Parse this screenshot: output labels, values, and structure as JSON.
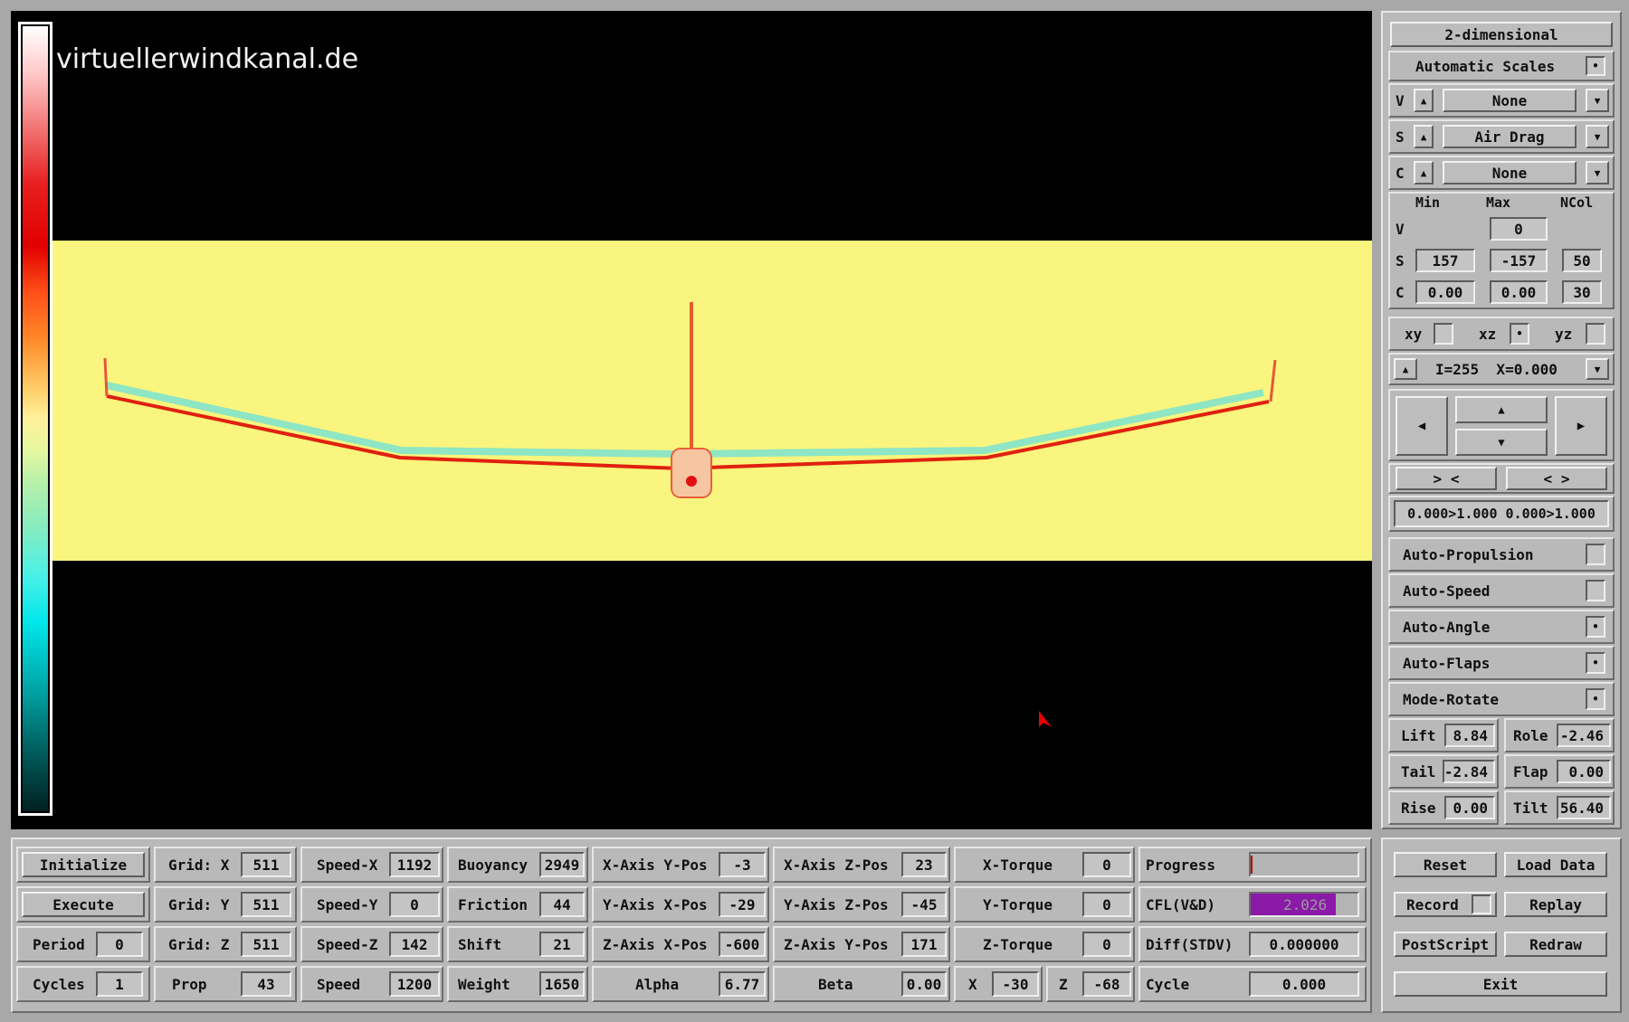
{
  "view": {
    "watermark": "virtuellerwindkanal.de"
  },
  "side": {
    "mode_button": "2-dimensional",
    "auto_scales": "Automatic Scales",
    "v_label": "V",
    "v_value": "None",
    "s_label": "S",
    "s_value": "Air Drag",
    "c_label": "C",
    "c_value": "None",
    "head_min": "Min",
    "head_max": "Max",
    "head_ncol": "NCol",
    "row_v": {
      "label": "V",
      "max": "0"
    },
    "row_s": {
      "label": "S",
      "min": "157",
      "max": "-157",
      "ncol": "50"
    },
    "row_c": {
      "label": "C",
      "min": "0.00",
      "max": "0.00",
      "ncol": "30"
    },
    "plane_xy": "xy",
    "plane_xz": "xz",
    "plane_yz": "yz",
    "slice_text": "I=255  X=0.000",
    "zoom_in": "> <",
    "zoom_out": "< >",
    "range_text": "0.000>1.000 0.000>1.000",
    "toggles": [
      "Auto-Propulsion",
      "Auto-Speed",
      "Auto-Angle",
      "Auto-Flaps",
      "Mode-Rotate"
    ],
    "lift_label": "Lift",
    "lift_value": "8.84",
    "role_label": "Role",
    "role_value": "-2.46",
    "tail_label": "Tail",
    "tail_value": "-2.84",
    "flap_label": "Flap",
    "flap_value": "0.00",
    "rise_label": "Rise",
    "rise_value": "0.00",
    "tilt_label": "Tilt",
    "tilt_value": "56.40"
  },
  "bottom": {
    "initialize": "Initialize",
    "execute": "Execute",
    "period_label": "Period",
    "period_value": "0",
    "cycles_label": "Cycles",
    "cycles_value": "1",
    "gridx_label": "Grid: X",
    "gridx_value": "511",
    "gridy_label": "Grid: Y",
    "gridy_value": "511",
    "gridz_label": "Grid: Z",
    "gridz_value": "511",
    "prop_label": "Prop",
    "prop_value": "43",
    "speedx_label": "Speed-X",
    "speedx_value": "1192",
    "speedy_label": "Speed-Y",
    "speedy_value": "0",
    "speedz_label": "Speed-Z",
    "speedz_value": "142",
    "speed_label": "Speed",
    "speed_value": "1200",
    "buoyancy_label": "Buoyancy",
    "buoyancy_value": "2949",
    "friction_label": "Friction",
    "friction_value": "44",
    "shift_label": "Shift",
    "shift_value": "21",
    "weight_label": "Weight",
    "weight_value": "1650",
    "xaxis_ypos_label": "X-Axis Y-Pos",
    "xaxis_ypos_value": "-3",
    "yaxis_xpos_label": "Y-Axis X-Pos",
    "yaxis_xpos_value": "-29",
    "zaxis_xpos_label": "Z-Axis X-Pos",
    "zaxis_xpos_value": "-600",
    "alpha_label": "Alpha",
    "alpha_value": "6.77",
    "xaxis_zpos_label": "X-Axis Z-Pos",
    "xaxis_zpos_value": "23",
    "yaxis_zpos_label": "Y-Axis Z-Pos",
    "yaxis_zpos_value": "-45",
    "zaxis_ypos_label": "Z-Axis Y-Pos",
    "zaxis_ypos_value": "171",
    "beta_label": "Beta",
    "beta_value": "0.00",
    "xtorque_label": "X-Torque",
    "xtorque_value": "0",
    "ytorque_label": "Y-Torque",
    "ytorque_value": "0",
    "ztorque_label": "Z-Torque",
    "ztorque_value": "0",
    "x_label": "X",
    "x_value": "-30",
    "z_label": "Z",
    "z_value": "-68",
    "progress_label": "Progress",
    "cfl_label": "CFL(V&D)",
    "cfl_value": "2.026",
    "diff_label": "Diff(STDV)",
    "diff_value": "0.000000",
    "cycle_label": "Cycle",
    "cycle_value": "0.000",
    "reset": "Reset",
    "load_data": "Load Data",
    "record": "Record",
    "replay": "Replay",
    "postscript": "PostScript",
    "redraw": "Redraw",
    "exit": "Exit"
  },
  "colors": {
    "view_bg": "#000000",
    "flow_field": "#f9f57e",
    "cfl_bar": "#8c1aa8"
  }
}
